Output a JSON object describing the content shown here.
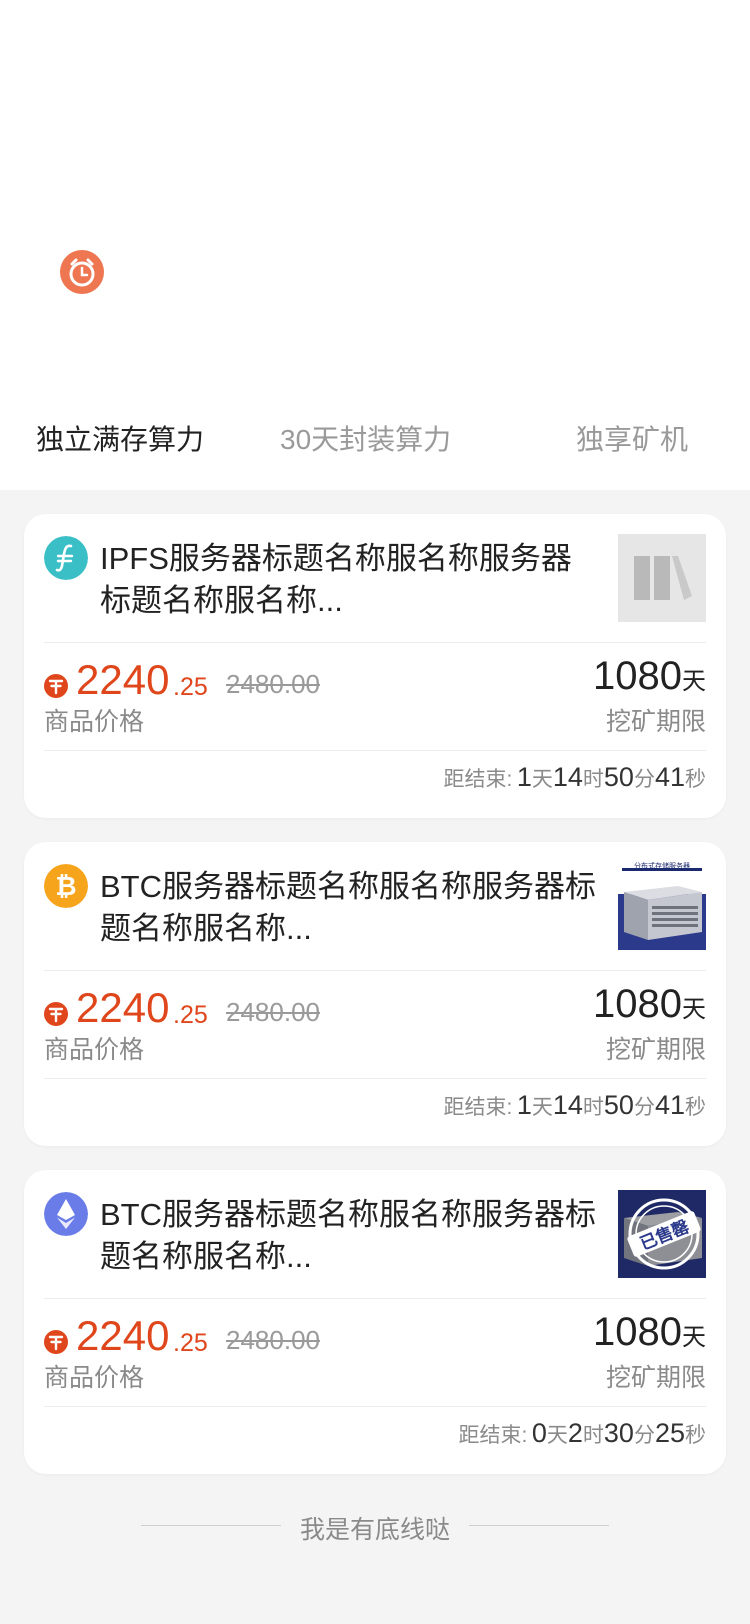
{
  "tabs": [
    {
      "label": "独立满存算力"
    },
    {
      "label": "30天封装算力"
    },
    {
      "label": "独享矿机"
    }
  ],
  "price_label": "商品价格",
  "days_label": "挖矿期限",
  "countdown_label": "距结束:",
  "products": [
    {
      "coin_icon": "filecoin-icon",
      "title": "IPFS服务器标题名称服名称服务器标题名称服名称...",
      "price_int": "2240",
      "price_dec": ".25",
      "price_old": "2480.00",
      "days": "1080",
      "days_unit": "天",
      "countdown": {
        "d": "1",
        "h": "14",
        "m": "50",
        "s": "41"
      },
      "thumb": "placeholder"
    },
    {
      "coin_icon": "bitcoin-icon",
      "title": "BTC服务器标题名称服名称服务器标题名称服名称...",
      "price_int": "2240",
      "price_dec": ".25",
      "price_old": "2480.00",
      "days": "1080",
      "days_unit": "天",
      "countdown": {
        "d": "1",
        "h": "14",
        "m": "50",
        "s": "41"
      },
      "thumb": "server",
      "thumb_caption": "分布式存储服务器"
    },
    {
      "coin_icon": "ethereum-icon",
      "title": "BTC服务器标题名称服名称服务器标题名称服名称...",
      "price_int": "2240",
      "price_dec": ".25",
      "price_old": "2480.00",
      "days": "1080",
      "days_unit": "天",
      "countdown": {
        "d": "0",
        "h": "2",
        "m": "30",
        "s": "25"
      },
      "thumb": "sold-out",
      "thumb_stamp": "已售罄"
    }
  ],
  "units": {
    "d": "天",
    "h": "时",
    "m": "分",
    "s": "秒"
  },
  "footer_text": "我是有底线哒",
  "colors": {
    "accent": "#e0461b",
    "filecoin": "#3bbfc7",
    "bitcoin": "#f7a41d",
    "ethereum": "#6a7ce8",
    "alarm": "#ee7650"
  }
}
